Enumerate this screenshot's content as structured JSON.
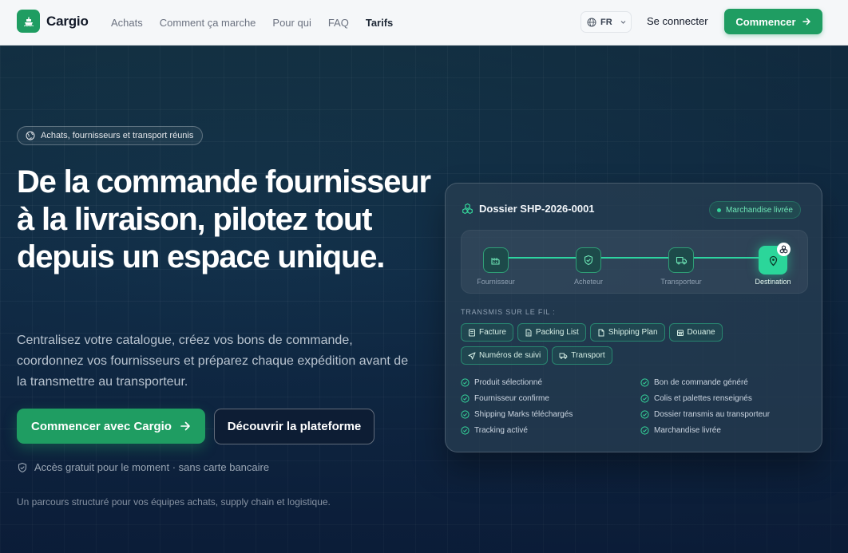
{
  "brand": {
    "name": "Cargio",
    "accent": "#1f9d62"
  },
  "nav": {
    "links": [
      {
        "label": "Achats",
        "active": false
      },
      {
        "label": "Comment ça marche",
        "active": false
      },
      {
        "label": "Pour qui",
        "active": false
      },
      {
        "label": "FAQ",
        "active": false
      },
      {
        "label": "Tarifs",
        "active": true
      }
    ],
    "language": "FR",
    "login_label": "Se connecter",
    "cta_label": "Commencer"
  },
  "hero": {
    "badge": "Achats, fournisseurs et transport réunis",
    "headline": "De la commande fournisseur à la livraison, pilotez tout depuis un espace unique.",
    "subtitle": "Centralisez votre catalogue, créez vos bons de commande, coordonnez vos fournisseurs et préparez chaque expédition avant de la transmettre au transporteur.",
    "primary_cta": "Commencer avec Cargio",
    "secondary_cta": "Découvrir la plateforme",
    "free_note": "Accès gratuit pour le moment · sans carte bancaire",
    "journey_note": "Un parcours structuré pour vos équipes achats, supply chain et logistique."
  },
  "card": {
    "title": "Dossier SHP-2026-0001",
    "status": "Marchandise livrée",
    "steps": [
      {
        "label": "Fournisseur",
        "icon": "factory-icon"
      },
      {
        "label": "Acheteur",
        "icon": "shield-icon"
      },
      {
        "label": "Transporteur",
        "icon": "truck-icon"
      },
      {
        "label": "Destination",
        "icon": "map-pin-icon"
      }
    ],
    "sent_title": "TRANSMIS SUR LE FIL :",
    "chips": [
      {
        "label": "Facture",
        "icon": "receipt-icon"
      },
      {
        "label": "Packing List",
        "icon": "file-icon"
      },
      {
        "label": "Shipping Plan",
        "icon": "file-icon"
      },
      {
        "label": "Douane",
        "icon": "building-icon"
      },
      {
        "label": "Numéros de suivi",
        "icon": "navigation-icon"
      },
      {
        "label": "Transport",
        "icon": "truck-icon"
      }
    ],
    "checks": [
      "Produit sélectionné",
      "Bon de commande généré",
      "Fournisseur confirme",
      "Colis et palettes renseignés",
      "Shipping Marks téléchargés",
      "Dossier transmis au transporteur",
      "Tracking activé",
      "Marchandise livrée"
    ]
  }
}
